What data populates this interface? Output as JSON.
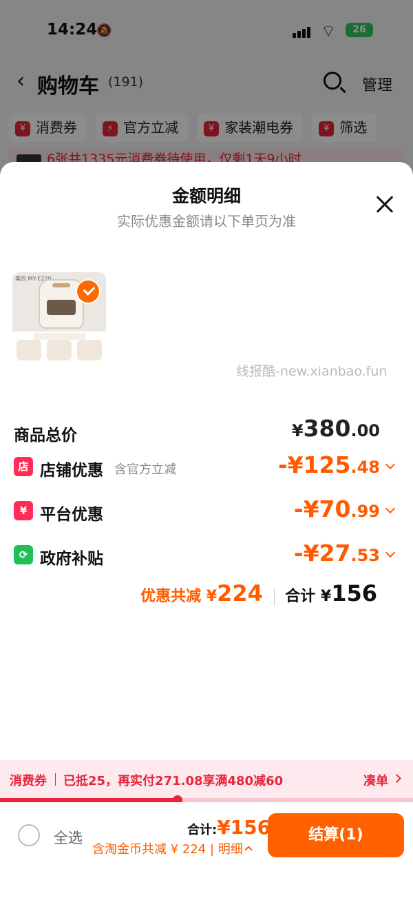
{
  "status_bar": {
    "time": "14:24",
    "battery": "26"
  },
  "header": {
    "title": "购物车",
    "count": "(191)",
    "manage": "管理"
  },
  "chips": [
    {
      "icon": "¥",
      "label": "消费券"
    },
    {
      "icon": "⚡",
      "label": "官方立减"
    },
    {
      "icon": "¥",
      "label": "家装潮电券"
    },
    {
      "icon": "¥",
      "label": "筛选"
    }
  ],
  "promo_banner": "6张共1335元消费券待使用，仅剩1天9小时",
  "sheet": {
    "title": "金额明细",
    "subtitle": "实际优惠金额请以下单页为准",
    "watermark": "线报酷-new.xianbao.fun",
    "product_label": "美的 MY-E220",
    "total": {
      "label": "商品总价",
      "yen": "¥",
      "int": "380",
      "dec": ".00"
    },
    "discounts": [
      {
        "icon": "店",
        "icon_color": "#ff2d55",
        "label": "店铺优惠",
        "sub": "含官方立减",
        "amount": "-¥125",
        "dec": ".48"
      },
      {
        "icon": "¥",
        "icon_color": "#ff2d55",
        "label": "平台优惠",
        "sub": "",
        "amount": "-¥70",
        "dec": ".99"
      },
      {
        "icon": "⟳",
        "icon_color": "#1fbf54",
        "label": "政府补贴",
        "sub": "",
        "amount": "-¥27",
        "dec": ".53"
      }
    ],
    "summary": {
      "discount_label": "优惠共减 ¥",
      "discount_value": "224",
      "total_label": "合计 ¥",
      "total_value": "156"
    }
  },
  "coupon_bar": {
    "label": "消费券",
    "text": "已抵25，再实付271.08享满480减60",
    "link": "凑单",
    "progress": 0.43
  },
  "bottom_bar": {
    "select_all": "全选",
    "total_label": "合计:",
    "total_value": "¥156",
    "detail": "含淘金币共减 ¥ 224 | 明细",
    "checkout": "结算(1)"
  }
}
